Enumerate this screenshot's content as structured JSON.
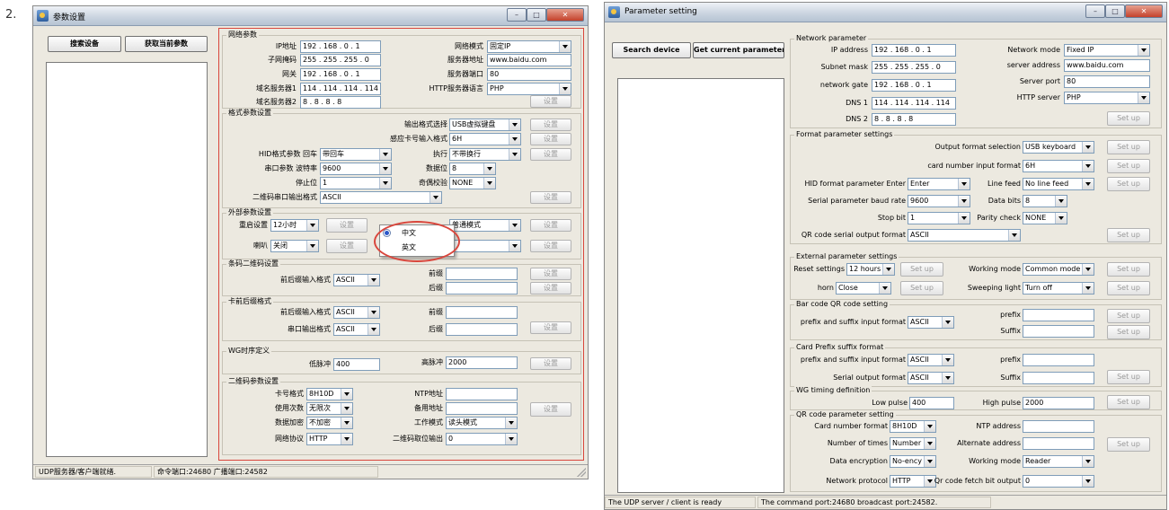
{
  "prefix": "2.",
  "left": {
    "title": "参数设置",
    "buttons": {
      "search": "搜索设备",
      "get": "获取当前参数"
    },
    "network": {
      "legend": "网络参数",
      "ip_label": "IP地址",
      "ip": "192 . 168 . 0 . 1",
      "mask_label": "子网掩码",
      "mask": "255 . 255 . 255 . 0",
      "gw_label": "网关",
      "gw": "192 . 168 . 0 . 1",
      "dns1_label": "域名服务器1",
      "dns1": "114 . 114 . 114 . 114",
      "dns2_label": "域名服务器2",
      "dns2": "8 . 8 . 8 . 8",
      "mode_label": "网络模式",
      "mode": "固定IP",
      "server_label": "服务器地址",
      "server": "www.baidu.com",
      "port_label": "服务器端口",
      "port": "80",
      "lang_label": "HTTP服务器语言",
      "lang": "PHP",
      "set": "设置"
    },
    "format": {
      "legend": "格式参数设置",
      "out_label": "输出格式选择",
      "out": "USB虚拟键盘",
      "card_label": "感应卡号输入格式",
      "card": "6H",
      "hid_label": "HID格式参数 回车",
      "hid": "带回车",
      "lf_label": "执行",
      "lf": "不带换行",
      "baud_label": "串口参数 波特率",
      "baud": "9600",
      "data_label": "数据位",
      "data": "8",
      "stop_label": "停止位",
      "stop": "1",
      "parity_label": "奇偶校验",
      "parity": "NONE",
      "qr_label": "二维码串口输出格式",
      "qr": "ASCII",
      "set": "设置"
    },
    "external": {
      "legend": "外部参数设置",
      "reset_label": "重启设置",
      "reset": "12小时",
      "work": "普通模式",
      "horn_label": "喇叭",
      "horn": "关闭",
      "set": "设置",
      "popup": {
        "zh": "中文",
        "en": "英文"
      }
    },
    "barcode": {
      "legend": "条码二维码设置",
      "fmt_label": "前后缀输入格式",
      "fmt": "ASCII",
      "pre_label": "前缀",
      "suf_label": "后缀",
      "set": "设置"
    },
    "card": {
      "legend": "卡前后缀格式",
      "fmt_label": "前后缀输入格式",
      "fmt": "ASCII",
      "pre_label": "前缀",
      "out_label": "串口输出格式",
      "out": "ASCII",
      "suf_label": "后缀",
      "set": "设置"
    },
    "wg": {
      "legend": "WG时序定义",
      "low_label": "低脉冲",
      "low": "400",
      "high_label": "高脉冲",
      "high": "2000",
      "set": "设置"
    },
    "qr": {
      "legend": "二维码参数设置",
      "cn_label": "卡号格式",
      "cn": "8H10D",
      "ntp_label": "NTP地址",
      "times_label": "使用次数",
      "times": "无限次",
      "alt_label": "备用地址",
      "enc_label": "数据加密",
      "enc": "不加密",
      "mode_label": "工作模式",
      "mode": "读头模式",
      "proto_label": "网络协议",
      "proto": "HTTP",
      "fetch_label": "二维码取位输出",
      "fetch": "0",
      "set": "设置"
    },
    "status": {
      "s1": "UDP服务器/客户端就绪.",
      "s2": "命令端口:24680 广播端口:24582"
    }
  },
  "right": {
    "title": "Parameter setting",
    "buttons": {
      "search": "Search device",
      "get": "Get current parameter"
    },
    "network": {
      "legend": "Network parameter",
      "ip_label": "IP address",
      "ip": "192 . 168 . 0 . 1",
      "mask_label": "Subnet mask",
      "mask": "255 . 255 . 255 . 0",
      "gw_label": "network gate",
      "gw": "192 . 168 . 0 . 1",
      "dns1_label": "DNS 1",
      "dns1": "114 . 114 . 114 . 114",
      "dns2_label": "DNS 2",
      "dns2": "8 . 8 . 8 . 8",
      "mode_label": "Network mode",
      "mode": "Fixed IP",
      "server_label": "server address",
      "server": "www.baidu.com",
      "port_label": "Server port",
      "port": "80",
      "http_label": "HTTP server",
      "http": "PHP",
      "set": "Set up"
    },
    "format": {
      "legend": "Format parameter settings",
      "out_label": "Output format selection",
      "out": "USB keyboard",
      "card_label": "card number input format",
      "card": "6H",
      "hid_label": "HID format parameter  Enter",
      "hid": "Enter",
      "lf_label": "Line feed",
      "lf": "No line feed",
      "baud_label": "Serial parameter baud rate",
      "baud": "9600",
      "data_label": "Data bits",
      "data": "8",
      "stop_label": "Stop bit",
      "stop": "1",
      "parity_label": "Parity check",
      "parity": "NONE",
      "qr_label": "QR code serial output format",
      "qr": "ASCII",
      "set": "Set up"
    },
    "external": {
      "legend": "External parameter settings",
      "reset_label": "Reset settings",
      "reset": "12 hours",
      "work_label": "Working mode",
      "work": "Common mode",
      "horn_label": "horn",
      "horn": "Close",
      "sweep_label": "Sweeping light",
      "sweep": "Turn off",
      "set": "Set up"
    },
    "barcode": {
      "legend": "Bar code QR code setting",
      "fmt_label": "prefix and suffix input format",
      "fmt": "ASCII",
      "pre_label": "prefix",
      "suf_label": "Suffix",
      "set": "Set up"
    },
    "card": {
      "legend": "Card Prefix suffix format",
      "fmt_label": "prefix and suffix input format",
      "fmt": "ASCII",
      "pre_label": "prefix",
      "out_label": "Serial output format",
      "out": "ASCII",
      "suf_label": "Suffix",
      "set": "Set up"
    },
    "wg": {
      "legend": "WG timing definition",
      "low_label": "Low pulse",
      "low": "400",
      "high_label": "High pulse",
      "high": "2000",
      "set": "Set up"
    },
    "qr": {
      "legend": "QR code parameter setting",
      "cn_label": "Card number format",
      "cn": "8H10D",
      "ntp_label": "NTP address",
      "times_label": "Number of times",
      "times": "Number",
      "alt_label": "Alternate address",
      "enc_label": "Data encryption",
      "enc": "No-ency",
      "mode_label": "Working mode",
      "mode": "Reader",
      "proto_label": "Network protocol",
      "proto": "HTTP",
      "fetch_label": "Qr code fetch bit output",
      "fetch": "0",
      "set": "Set up"
    },
    "status": {
      "s1": "The UDP server / client is ready",
      "s2": "The command port:24680 broadcast port:24582."
    }
  }
}
